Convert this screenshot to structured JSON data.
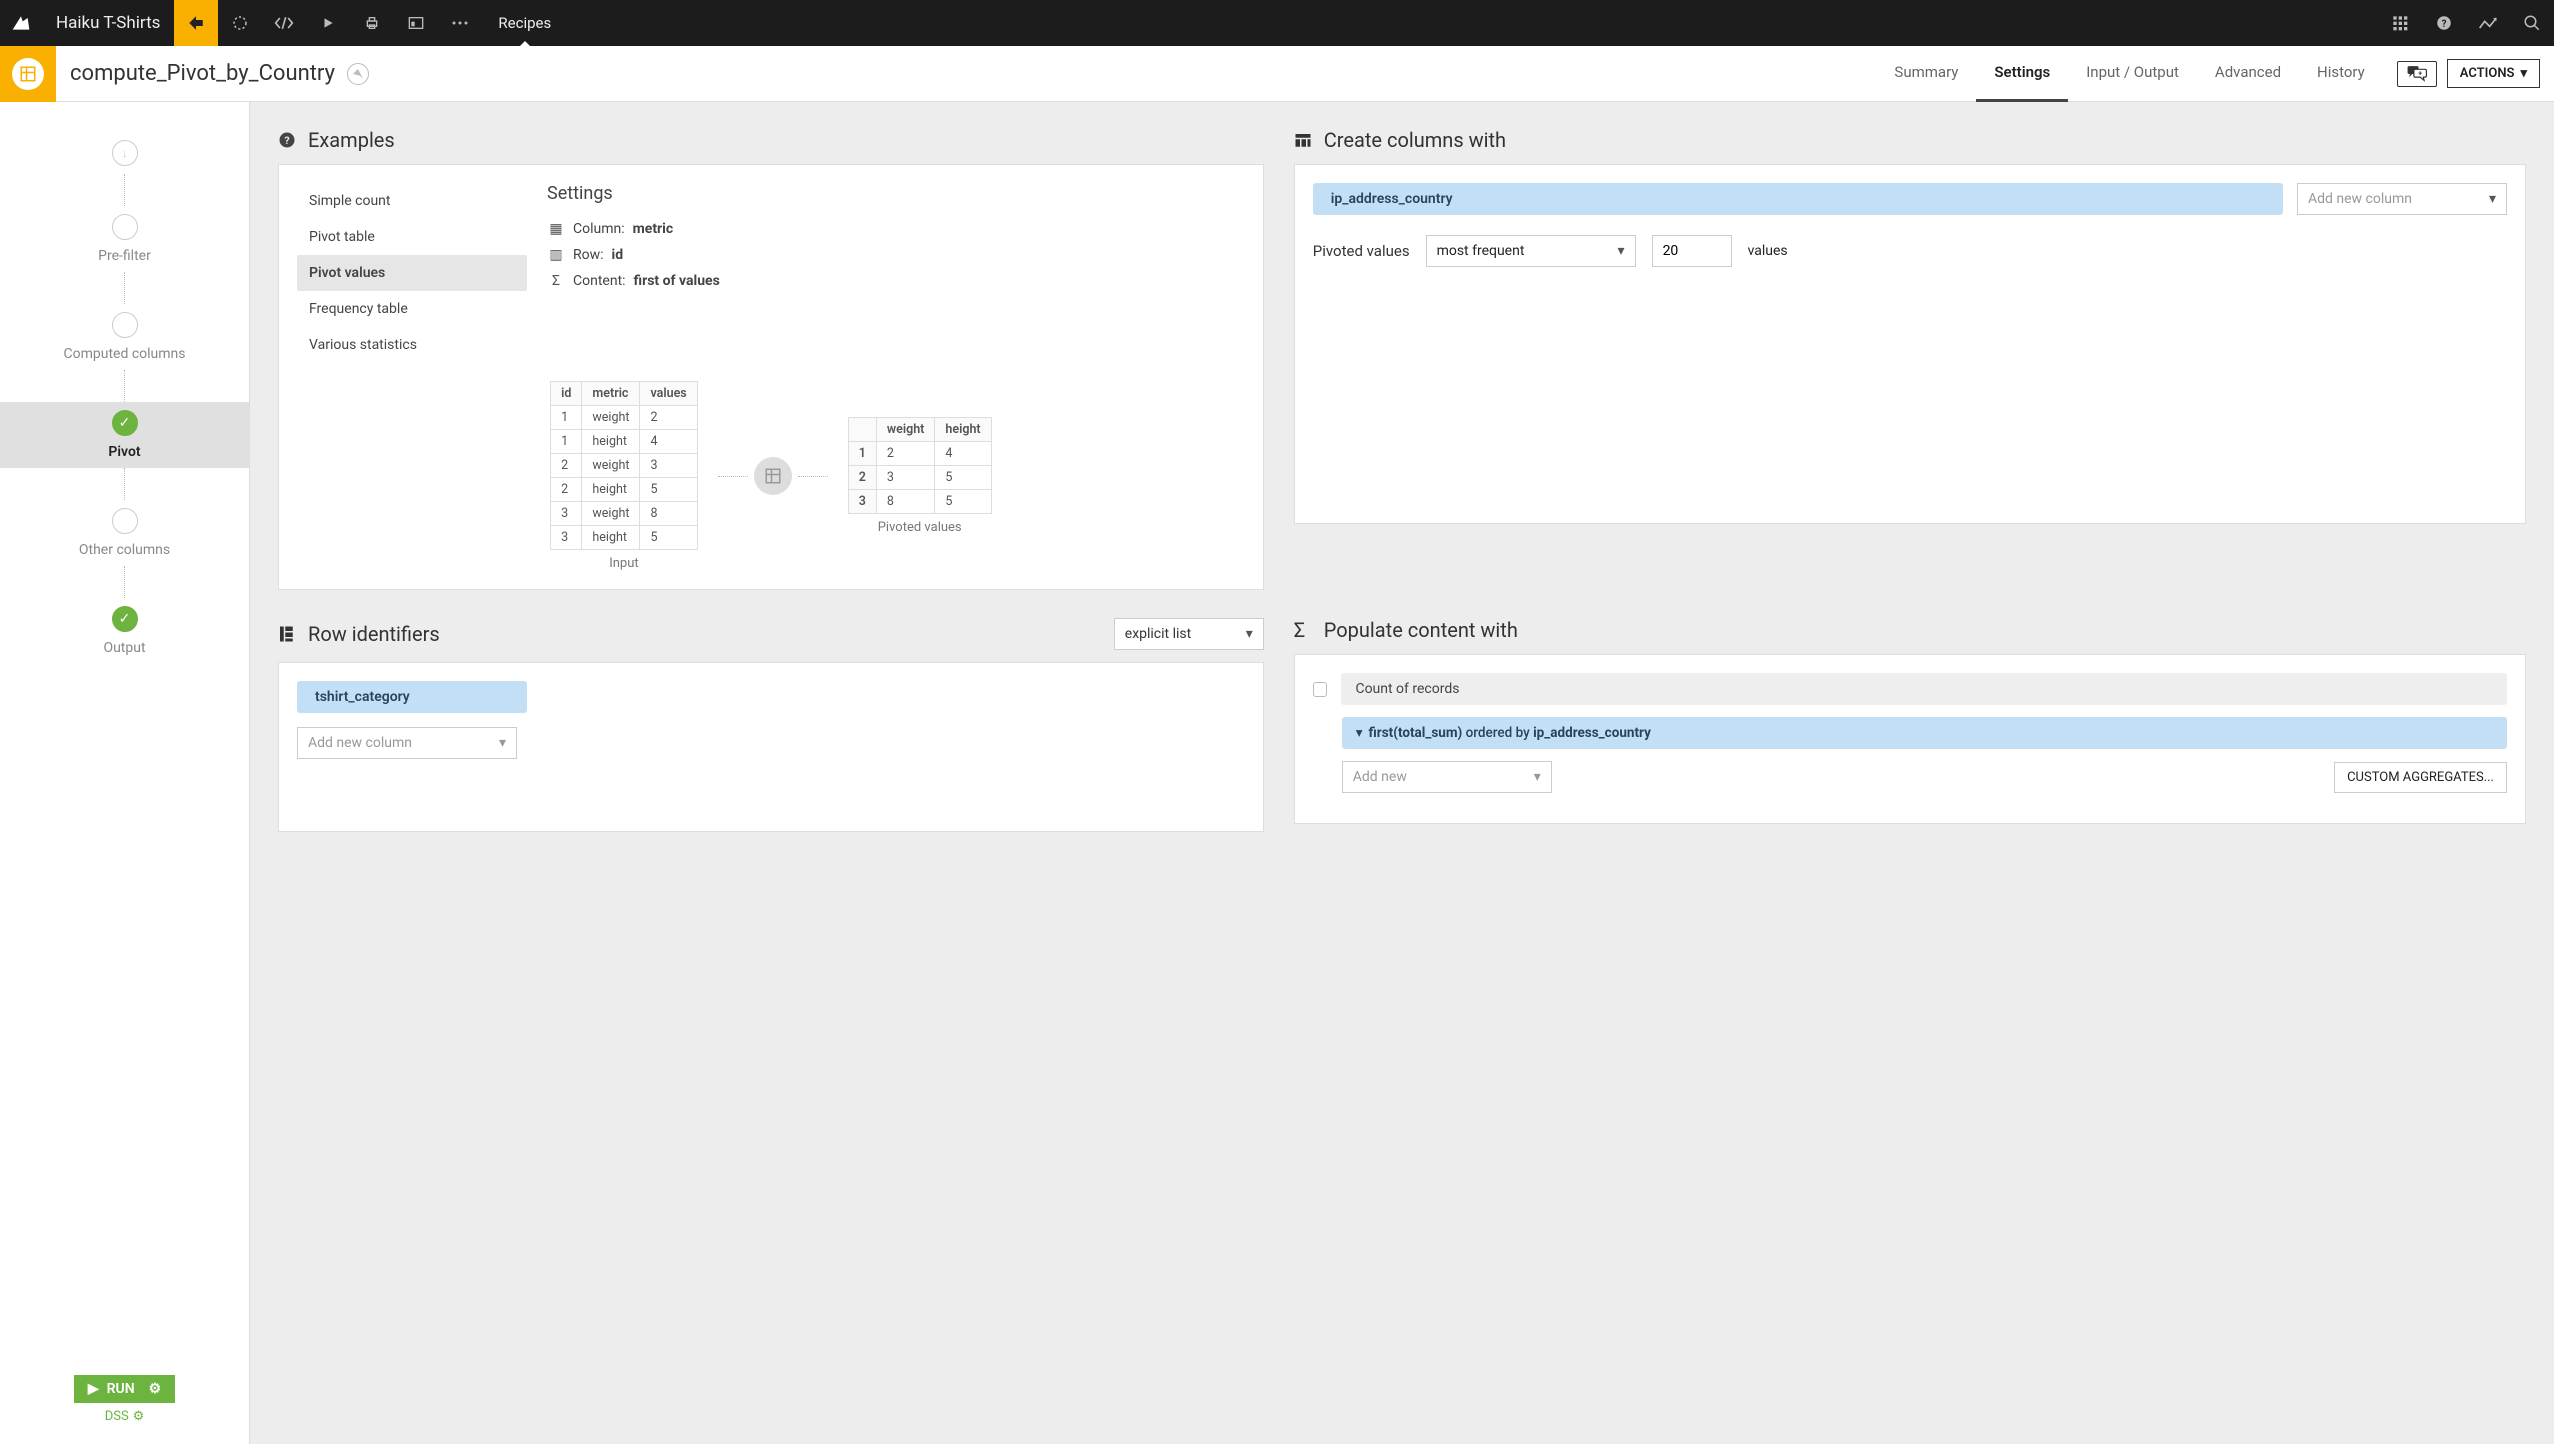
{
  "topbar": {
    "project": "Haiku T-Shirts",
    "active_tab": "Recipes"
  },
  "header": {
    "title": "compute_Pivot_by_Country",
    "tabs": [
      "Summary",
      "Settings",
      "Input / Output",
      "Advanced",
      "History"
    ],
    "active_tab": "Settings",
    "actions_label": "ACTIONS"
  },
  "steps": {
    "items": [
      {
        "label": "Pre-filter",
        "state": "empty"
      },
      {
        "label": "Computed columns",
        "state": "empty"
      },
      {
        "label": "Pivot",
        "state": "green",
        "active": true
      },
      {
        "label": "Other columns",
        "state": "empty"
      },
      {
        "label": "Output",
        "state": "green"
      }
    ],
    "run_label": "RUN",
    "dss_label": "DSS"
  },
  "examples": {
    "header": "Examples",
    "items": [
      "Simple count",
      "Pivot table",
      "Pivot values",
      "Frequency table",
      "Various statistics"
    ],
    "selected": "Pivot values",
    "settings_title": "Settings",
    "column_label": "Column:",
    "column_value": "metric",
    "row_label": "Row:",
    "row_value": "id",
    "content_label": "Content:",
    "content_value": "first of values",
    "input_caption": "Input",
    "output_caption": "Pivoted values",
    "input_table": {
      "headers": [
        "id",
        "metric",
        "values"
      ],
      "rows": [
        [
          "1",
          "weight",
          "2"
        ],
        [
          "1",
          "height",
          "4"
        ],
        [
          "2",
          "weight",
          "3"
        ],
        [
          "2",
          "height",
          "5"
        ],
        [
          "3",
          "weight",
          "8"
        ],
        [
          "3",
          "height",
          "5"
        ]
      ]
    },
    "output_table": {
      "headers": [
        "",
        "weight",
        "height"
      ],
      "rows": [
        [
          "1",
          "2",
          "4"
        ],
        [
          "2",
          "3",
          "5"
        ],
        [
          "3",
          "8",
          "5"
        ]
      ]
    }
  },
  "create_columns": {
    "header": "Create columns with",
    "chip": "ip_address_country",
    "add_new_placeholder": "Add new column",
    "pivoted_label": "Pivoted values",
    "mode": "most frequent",
    "count": "20",
    "suffix": "values"
  },
  "row_ids": {
    "header": "Row identifiers",
    "mode": "explicit list",
    "chip": "tshirt_category",
    "add_new_placeholder": "Add new column"
  },
  "populate": {
    "header": "Populate content with",
    "count_label": "Count of records",
    "agg_prefix": "first(total_sum)",
    "agg_mid": " ordered by ",
    "agg_col": "ip_address_country",
    "add_new_placeholder": "Add new",
    "custom_btn": "CUSTOM AGGREGATES..."
  }
}
